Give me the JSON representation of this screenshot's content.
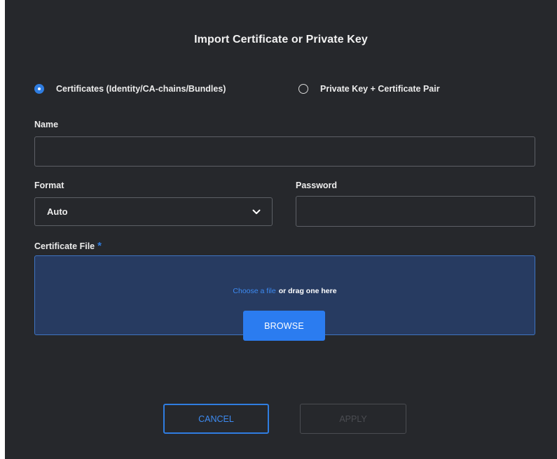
{
  "dialog": {
    "title": "Import Certificate or Private Key"
  },
  "import_type": {
    "options": [
      {
        "label": "Certificates (Identity/CA-chains/Bundles)",
        "selected": true
      },
      {
        "label": "Private Key + Certificate Pair",
        "selected": false
      }
    ]
  },
  "name_field": {
    "label": "Name",
    "value": ""
  },
  "format_field": {
    "label": "Format",
    "value": "Auto"
  },
  "password_field": {
    "label": "Password",
    "value": ""
  },
  "certificate_file": {
    "label": "Certificate File",
    "required_marker": "*",
    "choose_link": "Choose a file",
    "drag_text": "or drag one here",
    "browse_label": "BROWSE"
  },
  "actions": {
    "cancel_label": "CANCEL",
    "apply_label": "APPLY",
    "apply_enabled": false
  },
  "colors": {
    "dialog_bg": "#26282c",
    "accent": "#2f7de1",
    "dropzone_bg": "#273b61",
    "border": "#5d6066"
  },
  "icons": {
    "select_arrow": "chevron-down-icon"
  }
}
